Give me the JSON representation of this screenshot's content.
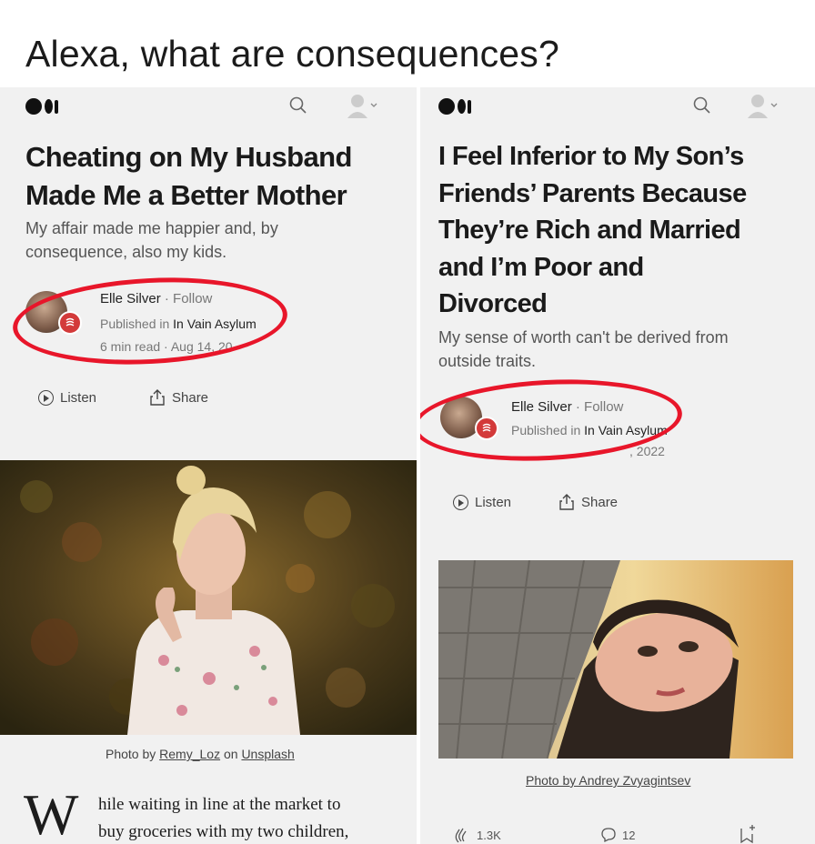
{
  "meme_caption": "Alexa, what are consequences?",
  "left_article": {
    "title_lines": [
      "Cheating on My Husband",
      "Made Me a Better Mother"
    ],
    "subtitle_lines": [
      "My affair made me happier and, by",
      "consequence, also my kids."
    ],
    "author_name": "Elle Silver",
    "follow_label": "Follow",
    "published_prefix": "Published in ",
    "publication": "In Vain Asylum",
    "read_time": "6 min read",
    "date": "Aug 14, 20",
    "listen_label": "Listen",
    "share_label": "Share",
    "photo_credit_prefix": "Photo by ",
    "photo_credit_author": "Remy_Loz",
    "photo_credit_middle": " on ",
    "photo_credit_site": "Unsplash",
    "dropcap": "W",
    "body_lines": [
      "hile waiting in line at the market to",
      "buy groceries with my two children,"
    ]
  },
  "right_article": {
    "title_lines": [
      "I Feel Inferior to My Son’s",
      "Friends’ Parents Because",
      "They’re Rich and Married",
      "and I’m Poor and",
      "Divorced"
    ],
    "subtitle_lines": [
      "My sense of worth can't be derived from",
      "outside traits."
    ],
    "author_name": "Elle Silver",
    "follow_label": "Follow",
    "published_prefix": "Published in ",
    "publication": "In Vain Asylum",
    "date_fragment": ", 2022",
    "listen_label": "Listen",
    "share_label": "Share",
    "photo_credit": "Photo by Andrey Zvyagintsev",
    "claps": "1.3K",
    "comments": "12"
  },
  "colors": {
    "annotation_red": "#e8162a",
    "panel_bg": "#f1f1f1",
    "medium_logo": "#111111"
  },
  "icons": {
    "logo": "medium-logo-icon",
    "search": "search-icon",
    "user": "user-avatar-icon",
    "play": "play-icon",
    "share": "share-icon",
    "clap": "clap-icon",
    "comment": "comment-icon",
    "bookmark": "bookmark-add-icon"
  }
}
